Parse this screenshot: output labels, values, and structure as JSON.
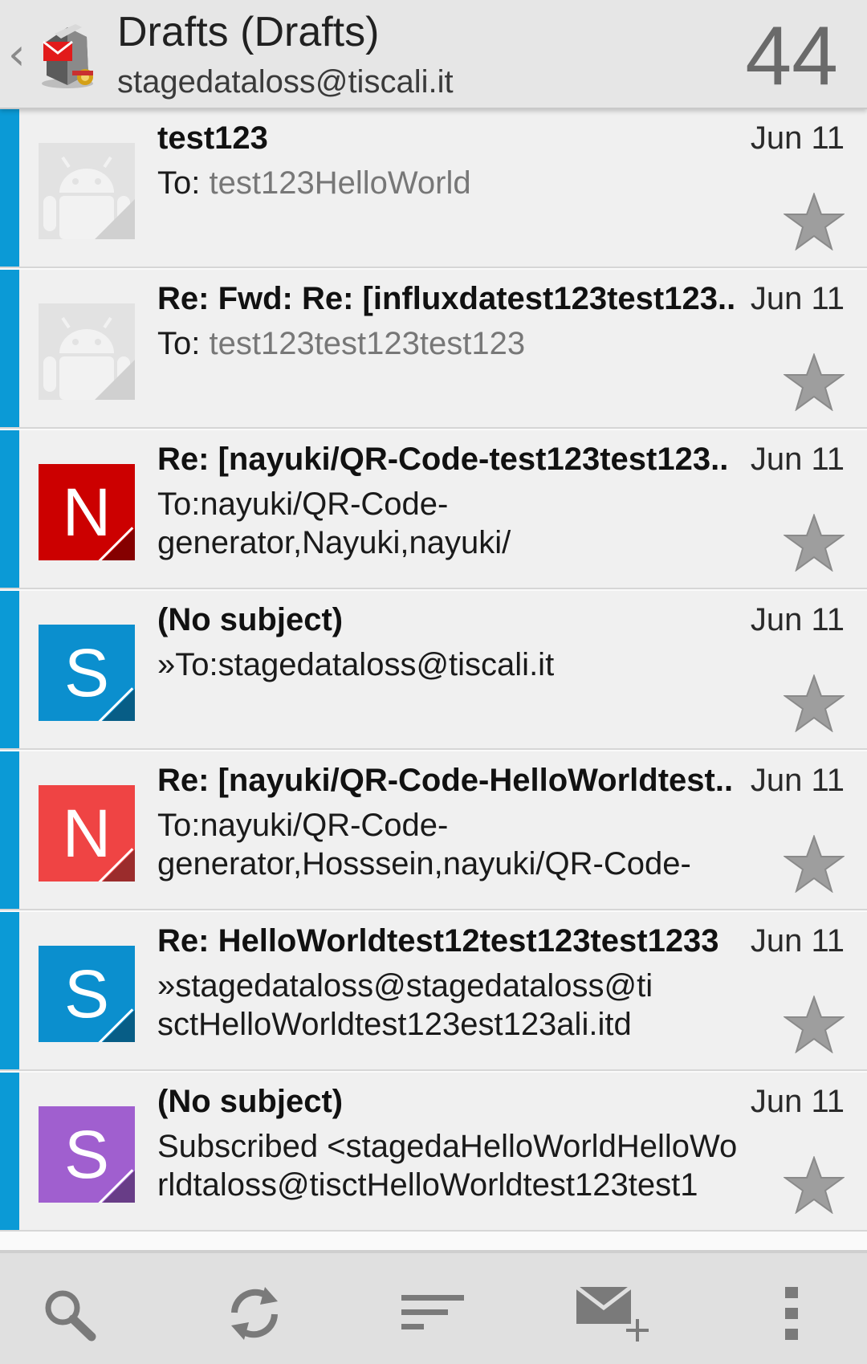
{
  "header": {
    "title": "Drafts (Drafts)",
    "account": "stagedataloss@tiscali.it",
    "count": "44",
    "back_icon": "chevron-left-icon",
    "app_icon": "k9-mail-dog-icon"
  },
  "messages": [
    {
      "subject": "test123",
      "date": "Jun 11",
      "to_label": "To: ",
      "recipient": "test123HelloWorld",
      "preview_lines": [],
      "avatar": {
        "type": "android",
        "color": "#e4e4e4"
      },
      "starred": false
    },
    {
      "subject": "Re: Fwd: Re: [influxdatest123test123..",
      "date": "Jun 11",
      "to_label": "To: ",
      "recipient": "test123test123test123",
      "preview_lines": [],
      "avatar": {
        "type": "android",
        "color": "#e4e4e4"
      },
      "starred": false
    },
    {
      "subject": "Re: [nayuki/QR-Code-test123test123..",
      "date": "Jun 11",
      "to_label": "",
      "recipient": "",
      "preview_lines": [
        "To:nayuki/QR-Code-",
        "generator,Nayuki,nayuki/"
      ],
      "avatar": {
        "type": "letter",
        "letter": "N",
        "color": "#cc0000"
      },
      "starred": false
    },
    {
      "subject": "(No subject)",
      "date": "Jun 11",
      "to_label": "",
      "recipient": "",
      "preview_lines": [
        "»To:stagedataloss@tiscali.it"
      ],
      "avatar": {
        "type": "letter",
        "letter": "S",
        "color": "#0b8fce"
      },
      "starred": false
    },
    {
      "subject": "Re: [nayuki/QR-Code-HelloWorldtest..",
      "date": "Jun 11",
      "to_label": "",
      "recipient": "",
      "preview_lines": [
        "To:nayuki/QR-Code-",
        "generator,Hosssein,nayuki/QR-Code-"
      ],
      "avatar": {
        "type": "letter",
        "letter": "N",
        "color": "#ef4444"
      },
      "starred": false
    },
    {
      "subject": "Re: HelloWorldtest12test123test1233",
      "date": "Jun 11",
      "to_label": "",
      "recipient": "",
      "preview_lines": [
        "»stagedataloss@stagedataloss@ti",
        "sctHelloWorldtest123est123ali.itd"
      ],
      "avatar": {
        "type": "letter",
        "letter": "S",
        "color": "#0b8fce"
      },
      "starred": false
    },
    {
      "subject": "(No subject)",
      "date": "Jun 11",
      "to_label": "",
      "recipient": "",
      "preview_lines": [
        "Subscribed <stagedaHelloWorldHelloWo",
        "rldtaloss@tisctHelloWorldtest123test1"
      ],
      "avatar": {
        "type": "letter",
        "letter": "S",
        "color": "#a05fcf"
      },
      "starred": false
    }
  ],
  "colors": {
    "unread_stripe": "#0b9ad6",
    "star_gray": "#9e9e9e"
  },
  "bottom_bar": [
    {
      "icon": "search-icon"
    },
    {
      "icon": "refresh-icon"
    },
    {
      "icon": "sort-icon"
    },
    {
      "icon": "compose-icon"
    },
    {
      "icon": "more-vert-icon"
    }
  ]
}
